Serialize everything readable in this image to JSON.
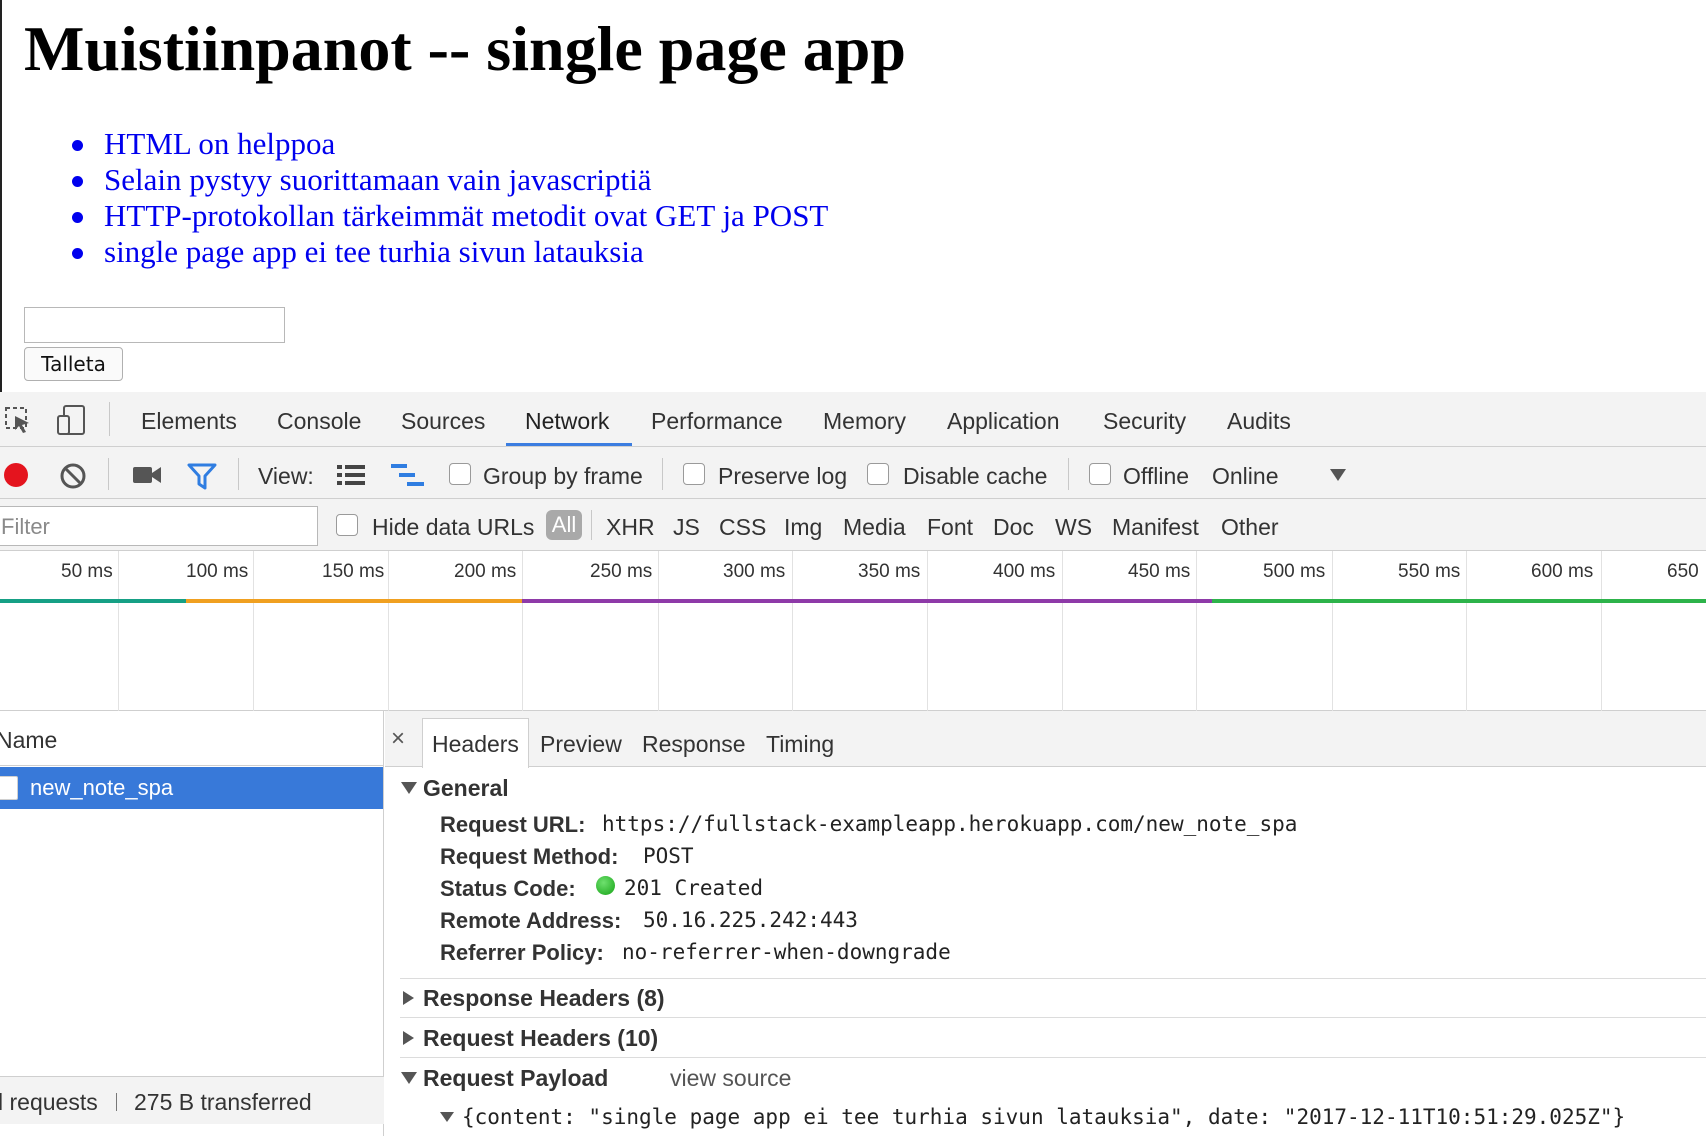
{
  "page": {
    "title": "Muistiinpanot -- single page app",
    "notes": [
      "HTML on helppoa",
      "Selain pystyy suorittamaan vain javascriptiä",
      "HTTP-protokollan tärkeimmät metodit ovat GET ja POST",
      "single page app ei tee turhia sivun latauksia"
    ],
    "save_label": "Talleta"
  },
  "devtools": {
    "tabs": [
      "Elements",
      "Console",
      "Sources",
      "Network",
      "Performance",
      "Memory",
      "Application",
      "Security",
      "Audits"
    ],
    "active_tab": "Network",
    "toolbar": {
      "view_label": "View:",
      "group_by_frame": "Group by frame",
      "preserve_log": "Preserve log",
      "disable_cache": "Disable cache",
      "offline": "Offline",
      "throttling": "Online"
    },
    "filterbar": {
      "filter_placeholder": "Filter",
      "hide_data_urls": "Hide data URLs",
      "types": [
        "All",
        "XHR",
        "JS",
        "CSS",
        "Img",
        "Media",
        "Font",
        "Doc",
        "WS",
        "Manifest",
        "Other"
      ],
      "active_type": "All"
    },
    "timeline": {
      "ticks": [
        "50 ms",
        "100 ms",
        "150 ms",
        "200 ms",
        "250 ms",
        "300 ms",
        "350 ms",
        "400 ms",
        "450 ms",
        "500 ms",
        "550 ms",
        "600 ms",
        "650"
      ]
    },
    "requests": {
      "column_name": "Name",
      "items": [
        "new_note_spa"
      ],
      "summary_requests": "l requests",
      "summary_transferred": "275 B transferred"
    },
    "details": {
      "close": "×",
      "tabs": [
        "Headers",
        "Preview",
        "Response",
        "Timing"
      ],
      "active_tab": "Headers",
      "general_title": "General",
      "general": [
        {
          "key": "Request URL:",
          "value": "https://fullstack-exampleapp.herokuapp.com/new_note_spa"
        },
        {
          "key": "Request Method:",
          "value": "POST"
        },
        {
          "key": "Status Code:",
          "value": "201 Created"
        },
        {
          "key": "Remote Address:",
          "value": "50.16.225.242:443"
        },
        {
          "key": "Referrer Policy:",
          "value": "no-referrer-when-downgrade"
        }
      ],
      "response_headers": "Response Headers (8)",
      "request_headers": "Request Headers (10)",
      "request_payload": "Request Payload",
      "view_source": "view source",
      "payload": "{content: \"single page app ei tee turhia sivun latauksia\", date: \"2017-12-11T10:51:29.025Z\"}"
    }
  },
  "colors": {
    "link": "#0000ee",
    "accent": "#3879d9",
    "record": "#e4141e",
    "filter_icon": "#2f7de1",
    "status_ok": "#16a316"
  },
  "icons": [
    "inspect-icon",
    "device-toolbar-icon",
    "record-icon",
    "clear-icon",
    "camera-icon",
    "filter-icon",
    "large-rows-icon",
    "waterfall-icon",
    "dropdown-arrow-icon",
    "close-icon"
  ]
}
